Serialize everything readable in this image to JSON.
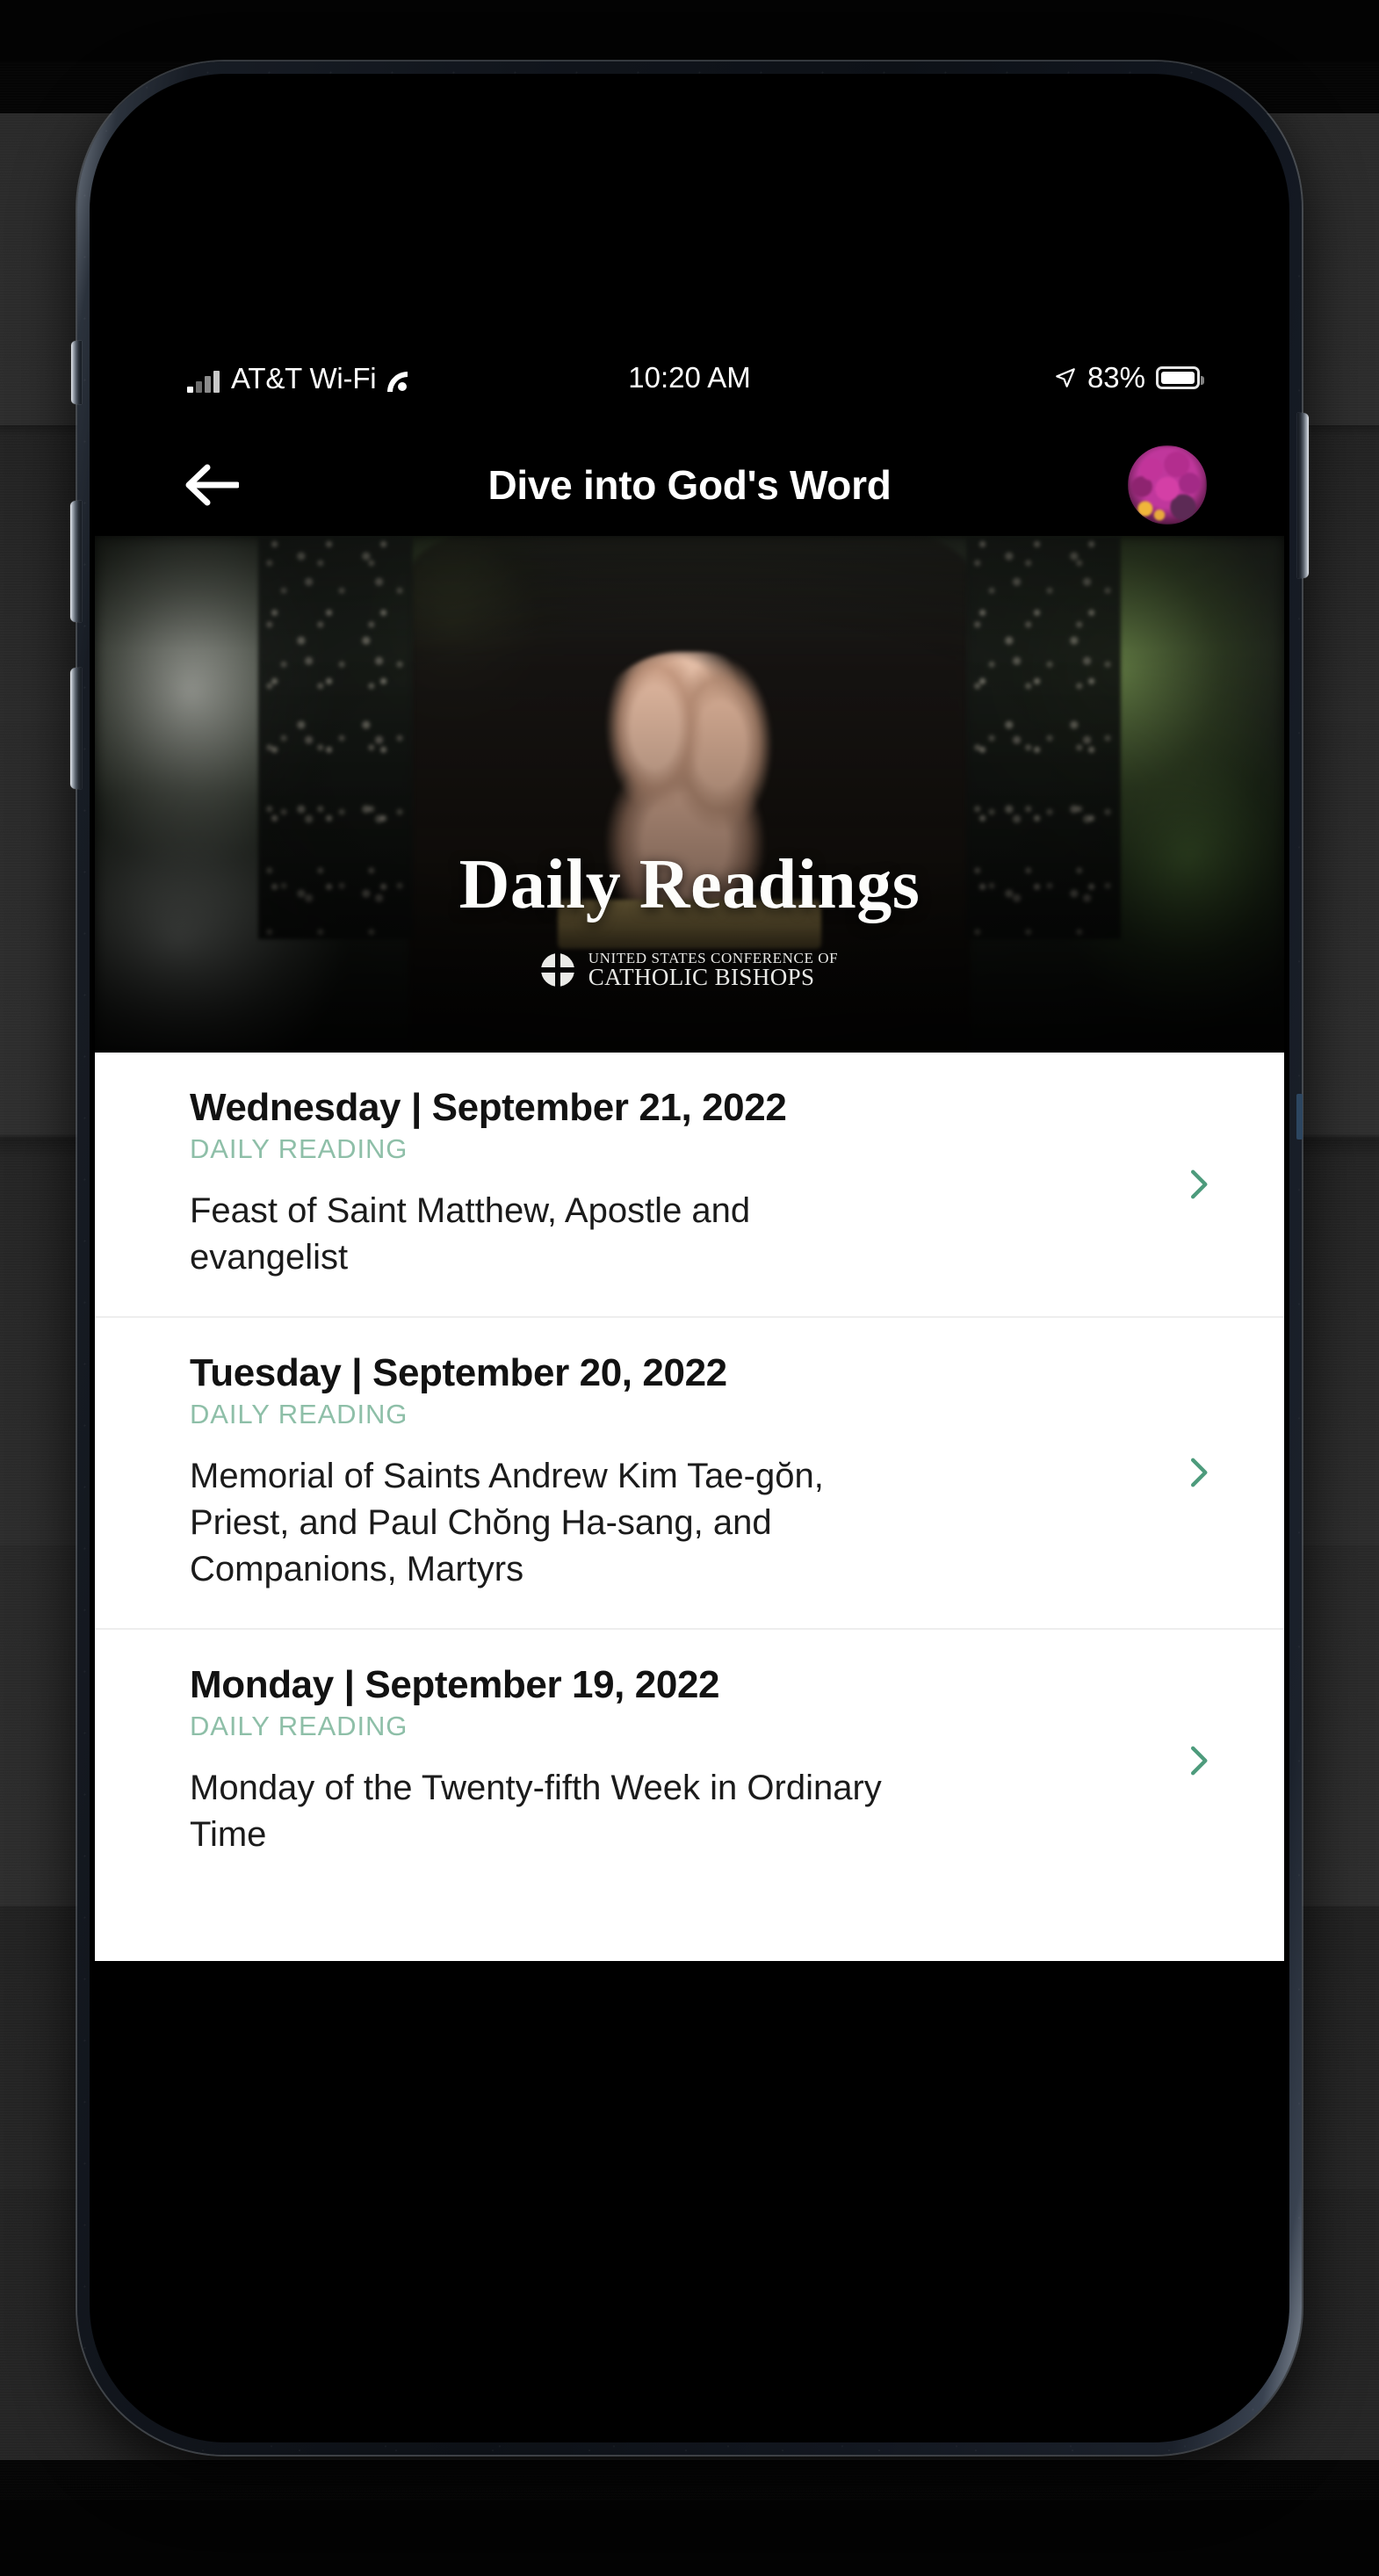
{
  "device": {
    "name": "smartphone-mockup",
    "frame_color": "#121720",
    "accent_color": "#2c4660"
  },
  "status_bar": {
    "carrier": "AT&T Wi-Fi",
    "signal_icon": "cellular-signal-icon",
    "wifi_icon": "wifi-icon",
    "time": "10:20 AM",
    "location_icon": "location-arrow-icon",
    "battery_percent": "83%",
    "battery_icon": "battery-icon",
    "battery_level": 83
  },
  "nav_bar": {
    "back_icon": "back-arrow-icon",
    "title": "Dive into God's Word",
    "avatar_alt": "profile-avatar"
  },
  "hero": {
    "title": "Daily Readings",
    "logo_line1": "UNITED STATES CONFERENCE OF",
    "logo_line2": "CATHOLIC BISHOPS",
    "logo_mark": "usccb-cross-circle-icon",
    "image_alt": "hands-clasped-in-prayer-over-book"
  },
  "theme": {
    "kicker_green": "#8ebfa8",
    "chevron_green": "#4d9b7c",
    "card_background": "#ffffff",
    "divider": "#eeeeee",
    "text_primary": "#121212"
  },
  "readings": [
    {
      "date": "Wednesday | September 21, 2022",
      "kicker": "DAILY READING",
      "description": "Feast of Saint Matthew, Apostle and evangelist",
      "chevron": "chevron-right-icon"
    },
    {
      "date": "Tuesday | September 20, 2022",
      "kicker": "DAILY READING",
      "description": "Memorial of Saints Andrew Kim Tae-gŏn, Priest, and Paul Chŏng Ha-sang, and Companions, Martyrs",
      "chevron": "chevron-right-icon"
    },
    {
      "date": "Monday | September 19, 2022",
      "kicker": "DAILY READING",
      "description": "Monday of the Twenty-fifth Week in Ordinary Time",
      "chevron": "chevron-right-icon"
    }
  ]
}
